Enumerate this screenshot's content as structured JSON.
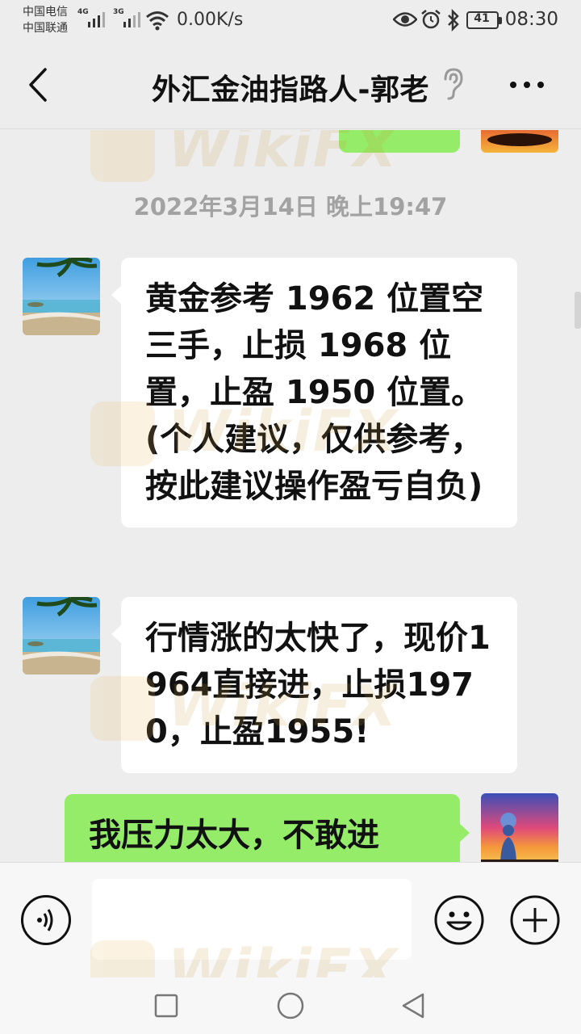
{
  "status_bar": {
    "carrier_1": "中国电信",
    "carrier_2": "中国联通",
    "signal_1_tag": "4G",
    "signal_2_tag": "3G",
    "network_speed": "0.00K/s",
    "battery": "41",
    "time": "08:30",
    "icons": [
      "eye-icon",
      "alarm-icon",
      "bluetooth-icon",
      "wifi-icon"
    ]
  },
  "header": {
    "title": "外汇金油指路人-郭老",
    "back_icon": "chevron-left-icon",
    "ear_icon": "ear-icon",
    "more_icon": "more-dots-icon"
  },
  "chat": {
    "timestamp": "2022年3月14日 晚上19:47",
    "messages": [
      {
        "side": "incoming",
        "text": "黄金参考 1962 位置空三手，止损 1968 位置，止盈 1950 位置。(个人建议，仅供参考，按此建议操作盈亏自负)"
      },
      {
        "side": "incoming",
        "text": "行情涨的太快了，现价1964直接进，止损1970，止盈1955!"
      },
      {
        "side": "outgoing",
        "text": "我压力太大，不敢进"
      }
    ],
    "watermark": "WikiFX"
  },
  "input_bar": {
    "placeholder": "",
    "voice_icon": "voice-icon",
    "emoji_icon": "emoji-icon",
    "add_icon": "plus-circle-icon"
  },
  "system_nav": {
    "icons": [
      "recent-apps-icon",
      "home-icon",
      "back-triangle-icon"
    ]
  },
  "colors": {
    "background": "#ededed",
    "incoming_bubble": "#ffffff",
    "outgoing_bubble": "#95ec69",
    "timestamp": "#a2a2a2"
  }
}
